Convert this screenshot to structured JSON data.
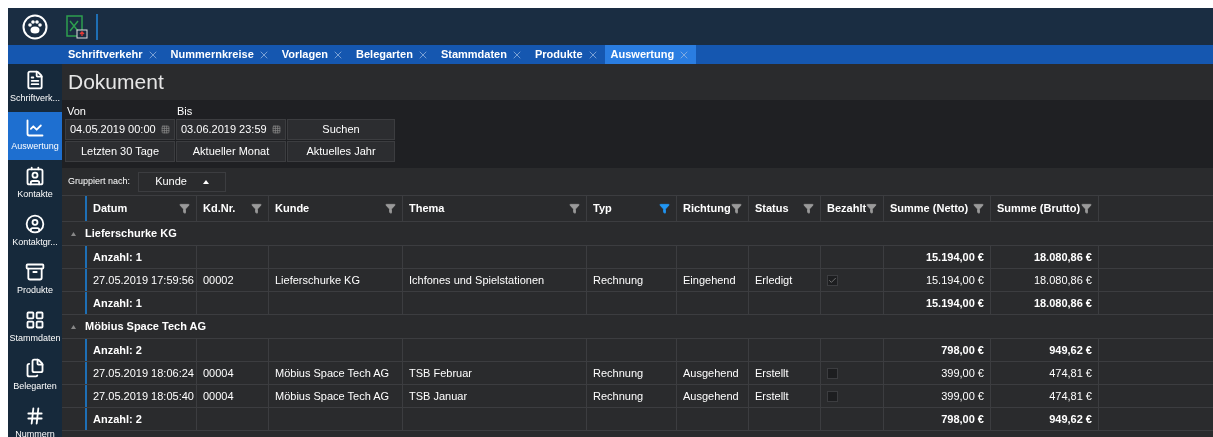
{
  "tabs": [
    {
      "label": "Schriftverkehr",
      "selected": false
    },
    {
      "label": "Nummernkreise",
      "selected": false
    },
    {
      "label": "Vorlagen",
      "selected": false
    },
    {
      "label": "Belegarten",
      "selected": false
    },
    {
      "label": "Stammdaten",
      "selected": false
    },
    {
      "label": "Produkte",
      "selected": false
    },
    {
      "label": "Auswertung",
      "selected": true
    }
  ],
  "sidebar": {
    "items": [
      {
        "label": "Schriftverk...",
        "selected": false
      },
      {
        "label": "Auswertung",
        "selected": true
      },
      {
        "label": "Kontakte",
        "selected": false
      },
      {
        "label": "Kontaktgr...",
        "selected": false
      },
      {
        "label": "Produkte",
        "selected": false
      },
      {
        "label": "Stammdaten",
        "selected": false
      },
      {
        "label": "Belegarten",
        "selected": false
      },
      {
        "label": "Nummern",
        "selected": false
      }
    ]
  },
  "page_title": "Dokument",
  "filters": {
    "from_label": "Von",
    "from_value": "04.05.2019 00:00",
    "to_label": "Bis",
    "to_value": "03.06.2019 23:59",
    "buttons": [
      "Suchen",
      "Letzten 30 Tage",
      "Aktueller Monat",
      "Aktuelles Jahr"
    ]
  },
  "grouping": {
    "label": "Gruppiert nach:",
    "value": "Kunde"
  },
  "table": {
    "columns": [
      {
        "label": "Datum",
        "filter_active": false
      },
      {
        "label": "Kd.Nr.",
        "filter_active": false
      },
      {
        "label": "Kunde",
        "filter_active": false
      },
      {
        "label": "Thema",
        "filter_active": false
      },
      {
        "label": "Typ",
        "filter_active": true
      },
      {
        "label": "Richtung",
        "filter_active": false
      },
      {
        "label": "Status",
        "filter_active": false
      },
      {
        "label": "Bezahlt",
        "filter_active": false
      },
      {
        "label": "Summe (Netto)",
        "filter_active": false
      },
      {
        "label": "Summe (Brutto)",
        "filter_active": false
      }
    ],
    "groups": [
      {
        "name": "Lieferschurke KG",
        "expanded": true,
        "summary_top": {
          "count": "Anzahl: 1",
          "netto": "15.194,00 €",
          "brutto": "18.080,86 €"
        },
        "rows": [
          {
            "datum": "27.05.2019 17:59:56",
            "kd_nr": "00002",
            "kunde": "Lieferschurke KG",
            "thema": "Ichfones und Spielstationen",
            "typ": "Rechnung",
            "richtung": "Eingehend",
            "status": "Erledigt",
            "bezahlt": true,
            "netto": "15.194,00 €",
            "brutto": "18.080,86 €"
          }
        ],
        "summary_bottom": {
          "count": "Anzahl: 1",
          "netto": "15.194,00 €",
          "brutto": "18.080,86 €"
        }
      },
      {
        "name": "Möbius Space Tech AG",
        "expanded": true,
        "summary_top": {
          "count": "Anzahl: 2",
          "netto": "798,00 €",
          "brutto": "949,62 €"
        },
        "rows": [
          {
            "datum": "27.05.2019 18:06:24",
            "kd_nr": "00004",
            "kunde": "Möbius Space Tech AG",
            "thema": "TSB Februar",
            "typ": "Rechnung",
            "richtung": "Ausgehend",
            "status": "Erstellt",
            "bezahlt": false,
            "netto": "399,00 €",
            "brutto": "474,81 €"
          },
          {
            "datum": "27.05.2019 18:05:40",
            "kd_nr": "00004",
            "kunde": "Möbius Space Tech AG",
            "thema": "TSB Januar",
            "typ": "Rechnung",
            "richtung": "Ausgehend",
            "status": "Erstellt",
            "bezahlt": false,
            "netto": "399,00 €",
            "brutto": "474,81 €"
          }
        ],
        "summary_bottom": {
          "count": "Anzahl: 2",
          "netto": "798,00 €",
          "brutto": "949,62 €"
        }
      }
    ]
  }
}
